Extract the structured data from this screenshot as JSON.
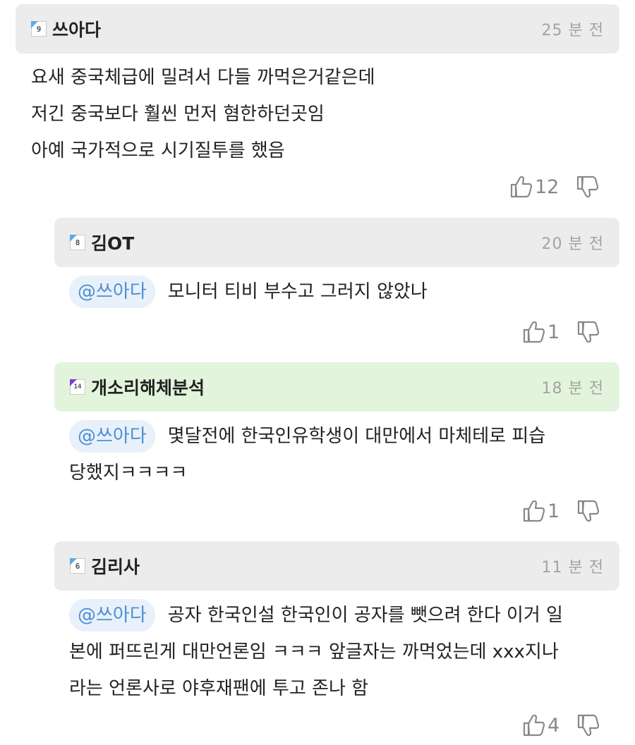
{
  "comments": [
    {
      "level": "9",
      "level_color": "#5aa9e6",
      "nickname": "쓰아다",
      "time": "25 분 전",
      "mention": "",
      "lines": [
        "요새 중국체급에 밀려서 다들 까먹은거같은데",
        "저긴 중국보다 훨씬 먼저 혐한하던곳임",
        "아예 국가적으로 시기질투를 했음"
      ],
      "likes": "12"
    },
    {
      "level": "8",
      "level_color": "#5aa9e6",
      "nickname": "김OT",
      "time": "20 분 전",
      "mention": "@쓰아다",
      "lines": [
        "모니터 티비 부수고 그러지 않았나"
      ],
      "likes": "1"
    },
    {
      "level": "14",
      "level_color": "#7b3fc9",
      "nickname": "개소리해체분석",
      "time": "18 분 전",
      "mention": "@쓰아다",
      "lines": [
        "몇달전에 한국인유학생이 대만에서 마체테로 피습",
        "당했지ㅋㅋㅋㅋ"
      ],
      "likes": "1"
    },
    {
      "level": "6",
      "level_color": "#5aa9e6",
      "nickname": "김리사",
      "time": "11 분 전",
      "mention": "@쓰아다",
      "lines": [
        "공자 한국인설 한국인이 공자를 뺏으려 한다 이거 일",
        "본에 퍼뜨린게 대만언론임 ㅋㅋㅋ 앞글자는 까먹었는데 xxx지나",
        "라는 언론사로 야후재팬에 투고 존나 함"
      ],
      "likes": "4"
    }
  ]
}
